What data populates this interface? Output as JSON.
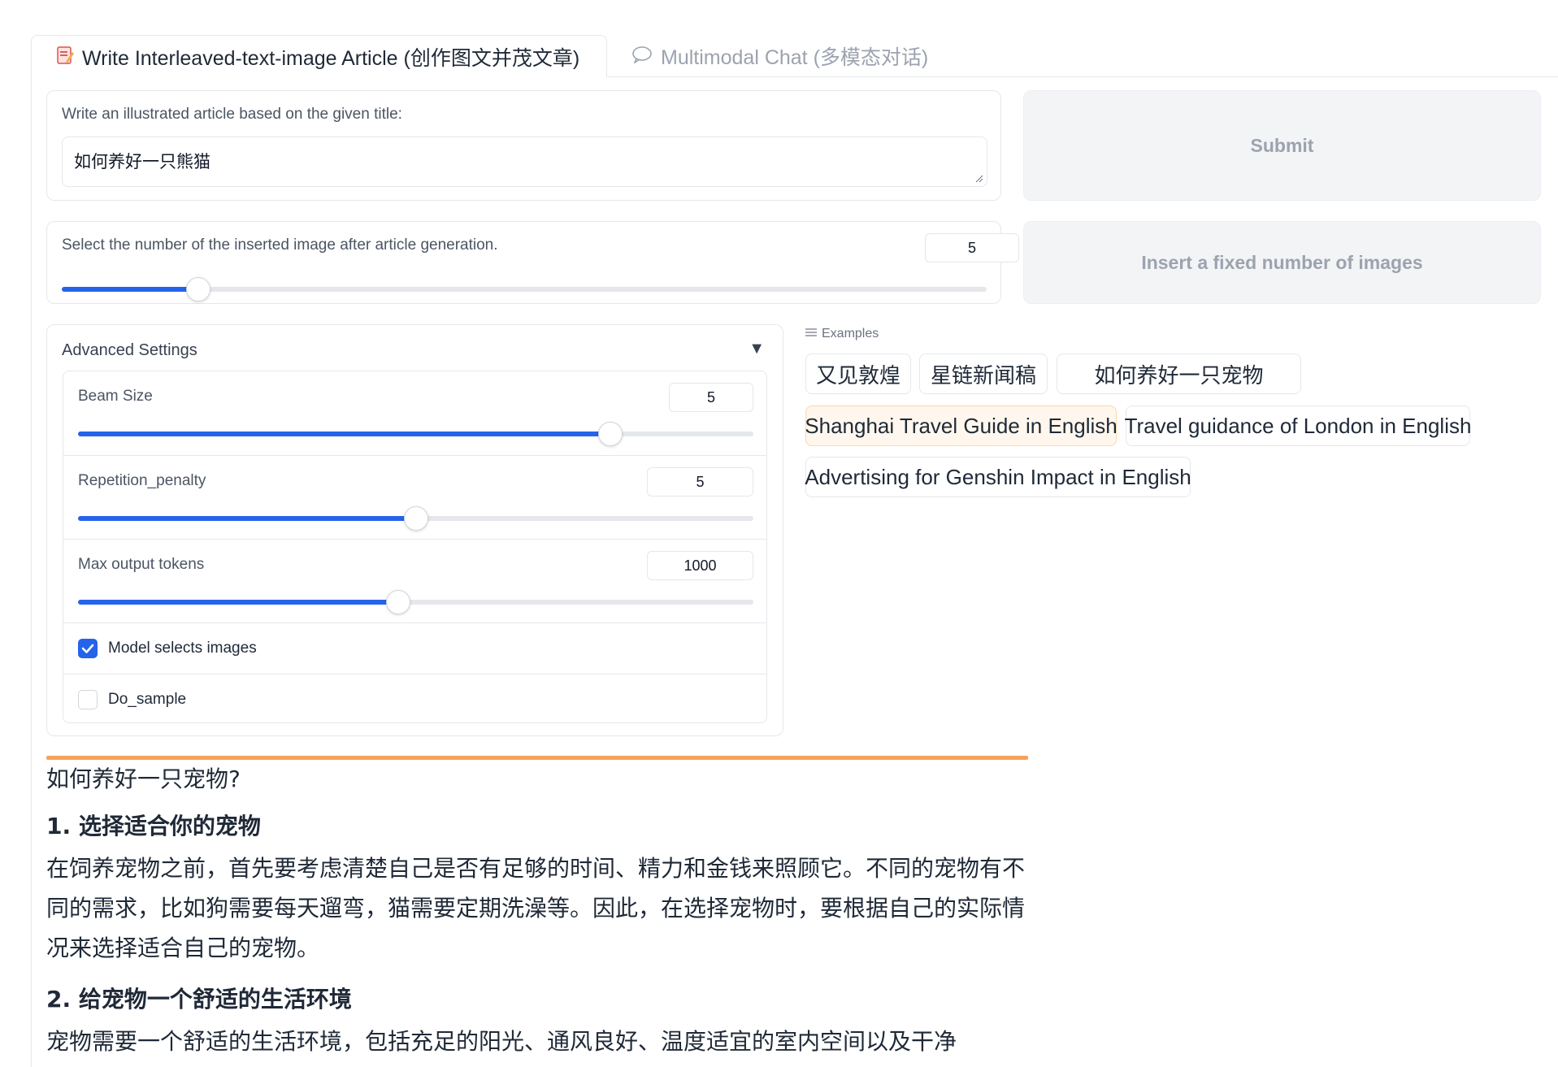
{
  "tabs": {
    "active_label": "Write Interleaved-text-image Article (创作图文并茂文章)",
    "inactive_label": "Multimodal Chat (多模态对话)"
  },
  "title_input": {
    "label": "Write an illustrated article based on the given title:",
    "value": "如何养好一只熊猫"
  },
  "submit_label": "Submit",
  "image_count": {
    "label": "Select the number of the inserted image after article generation.",
    "value": "5",
    "fraction": 0.148
  },
  "insert_button_label": "Insert a fixed number of images",
  "advanced": {
    "title": "Advanced Settings",
    "beam_size": {
      "label": "Beam Size",
      "value": "5",
      "fraction": 0.788
    },
    "repetition_penalty": {
      "label": "Repetition_penalty",
      "value": "5",
      "fraction": 0.5
    },
    "max_tokens": {
      "label": "Max output tokens",
      "value": "1000",
      "fraction": 0.474
    },
    "model_selects_images": {
      "label": "Model selects images",
      "checked": true
    },
    "do_sample": {
      "label": "Do_sample",
      "checked": false
    }
  },
  "examples": {
    "header": "Examples",
    "items": [
      "又见敦煌",
      "星链新闻稿",
      "如何养好一只宠物",
      "Shanghai Travel Guide in English",
      "Travel guidance of London in English",
      "Advertising for Genshin Impact in English"
    ]
  },
  "output": {
    "heading": "如何养好一只宠物?",
    "section1_title": "1. 选择适合你的宠物",
    "section1_body": "在饲养宠物之前，首先要考虑清楚自己是否有足够的时间、精力和金钱来照顾它。不同的宠物有不同的需求，比如狗需要每天遛弯，猫需要定期洗澡等。因此，在选择宠物时，要根据自己的实际情况来选择适合自己的宠物。",
    "section2_title": "2. 给宠物一个舒适的生活环境",
    "section2_body": "宠物需要一个舒适的生活环境，包括充足的阳光、通风良好、温度适宜的室内空间以及干净"
  },
  "colors": {
    "accent": "#2563eb",
    "progress": "#f4a259",
    "highlight_bg": "#fff7ed"
  }
}
